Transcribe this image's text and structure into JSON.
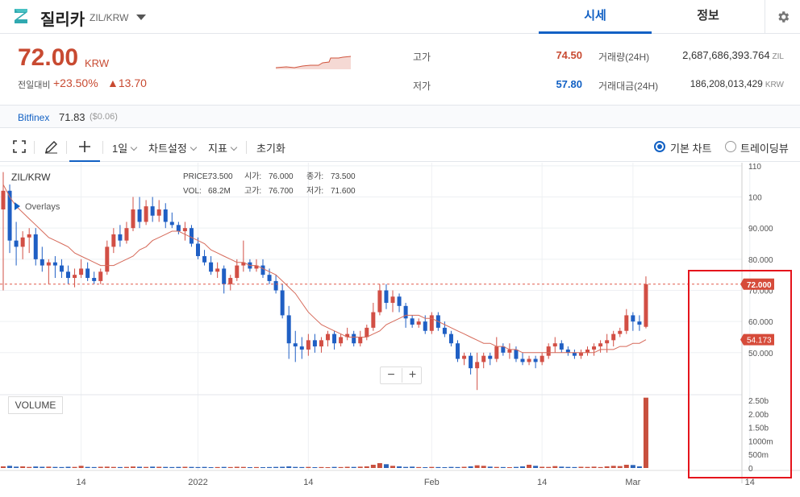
{
  "header": {
    "coin_name": "질리카",
    "pair": "ZIL/KRW",
    "tabs": [
      "시세",
      "정보"
    ],
    "active_tab": "시세"
  },
  "ticker": {
    "price": "72.00",
    "currency": "KRW",
    "change_label": "전일대비",
    "change_rate": "+23.50%",
    "change_amount": "▲13.70",
    "high_label": "고가",
    "high_value": "74.50",
    "low_label": "저가",
    "low_value": "57.80",
    "volume_label": "거래량(24H)",
    "volume_value": "2,687,686,393.764",
    "volume_unit": "ZIL",
    "amount_label": "거래대금(24H)",
    "amount_value": "186,208,013,429",
    "amount_unit": "KRW"
  },
  "bitfinex": {
    "name": "Bitfinex",
    "price": "71.83",
    "diff": "($0.06)"
  },
  "toolbar": {
    "interval": "1일",
    "chart_settings": "차트설정",
    "indicators": "지표",
    "reset": "초기화",
    "basic_chart": "기본 차트",
    "tradingview": "트레이딩뷰"
  },
  "chart_info": {
    "pair": "ZIL/KRW",
    "overlays": "Overlays",
    "price_label": "PRICE:",
    "price": "73.500",
    "open_label": "시가:",
    "open": "76.000",
    "close_label": "종가:",
    "close": "73.500",
    "vol_label": "VOL:",
    "vol": "68.2M",
    "high_label": "고가:",
    "high": "76.700",
    "low_label": "저가:",
    "low": "71.600",
    "volume_title": "VOLUME",
    "current_price_tag": "72.000",
    "ma_tag": "54.173",
    "zoom_out": "−",
    "zoom_in": "+"
  },
  "chart_data": {
    "type": "candlestick",
    "y_ticks": [
      "110",
      "100",
      "90.000",
      "80.000",
      "70.000",
      "60.000",
      "50.000"
    ],
    "y_tick_values": [
      110,
      100,
      90,
      80,
      70,
      60,
      50
    ],
    "vol_ticks": [
      "2.50b",
      "2.00b",
      "1.50b",
      "1000m",
      "500m",
      "0"
    ],
    "vol_tick_values": [
      2500,
      2000,
      1500,
      1000,
      500,
      0
    ],
    "x_ticks": [
      "14",
      "2022",
      "14",
      "Feb",
      "14",
      "Mar",
      "14"
    ],
    "x_tick_positions": [
      12,
      30,
      47,
      66,
      83,
      97,
      115
    ],
    "price_range": [
      36.5,
      111
    ],
    "vol_range": [
      0,
      2650
    ],
    "current_price": 72,
    "ma_last": 54.173,
    "candles": [
      [
        96,
        108,
        70,
        102
      ],
      [
        102,
        104,
        82,
        86
      ],
      [
        86,
        92,
        78,
        84
      ],
      [
        84,
        89,
        80,
        87
      ],
      [
        87,
        90,
        82,
        88
      ],
      [
        88,
        90,
        78,
        80
      ],
      [
        80,
        84,
        76,
        78
      ],
      [
        78,
        80,
        72,
        79
      ],
      [
        79,
        81,
        74,
        78
      ],
      [
        78,
        80,
        74,
        76
      ],
      [
        76,
        78,
        72,
        74
      ],
      [
        74,
        77,
        71,
        75
      ],
      [
        75,
        80,
        74,
        77
      ],
      [
        77,
        79,
        73,
        74
      ],
      [
        74,
        76,
        72,
        73
      ],
      [
        73,
        77,
        72,
        76
      ],
      [
        76,
        86,
        75,
        84
      ],
      [
        84,
        90,
        82,
        88
      ],
      [
        88,
        91,
        84,
        86
      ],
      [
        86,
        92,
        85,
        90
      ],
      [
        90,
        100,
        89,
        96
      ],
      [
        96,
        100,
        90,
        92
      ],
      [
        92,
        99,
        91,
        97
      ],
      [
        97,
        100,
        92,
        94
      ],
      [
        94,
        99,
        92,
        96
      ],
      [
        96,
        98,
        90,
        92
      ],
      [
        92,
        95,
        90,
        91
      ],
      [
        91,
        92,
        88,
        89
      ],
      [
        89,
        92,
        86,
        90
      ],
      [
        90,
        91,
        84,
        85
      ],
      [
        85,
        87,
        80,
        81
      ],
      [
        81,
        83,
        78,
        79
      ],
      [
        79,
        81,
        75,
        76
      ],
      [
        76,
        79,
        74,
        77
      ],
      [
        77,
        78,
        69,
        72
      ],
      [
        72,
        75,
        70,
        74
      ],
      [
        74,
        80,
        73,
        78
      ],
      [
        78,
        86,
        76,
        79
      ],
      [
        79,
        80,
        76,
        77
      ],
      [
        77,
        80,
        76,
        78
      ],
      [
        78,
        80,
        74,
        75
      ],
      [
        75,
        77,
        72,
        73
      ],
      [
        73,
        75,
        69,
        70
      ],
      [
        70,
        72,
        61,
        62
      ],
      [
        62,
        65,
        48,
        53
      ],
      [
        53,
        57,
        47,
        52
      ],
      [
        52,
        55,
        48,
        51
      ],
      [
        51,
        56,
        49,
        54
      ],
      [
        54,
        56,
        50,
        52
      ],
      [
        52,
        55,
        50,
        54
      ],
      [
        54,
        57,
        52,
        56
      ],
      [
        56,
        57,
        51,
        53
      ],
      [
        53,
        56,
        52,
        55
      ],
      [
        55,
        58,
        54,
        56
      ],
      [
        56,
        57,
        52,
        53
      ],
      [
        53,
        57,
        52,
        55
      ],
      [
        55,
        59,
        54,
        58
      ],
      [
        58,
        66,
        57,
        63
      ],
      [
        63,
        72,
        62,
        70
      ],
      [
        70,
        72,
        64,
        66
      ],
      [
        66,
        70,
        63,
        68
      ],
      [
        68,
        69,
        63,
        65
      ],
      [
        65,
        66,
        58,
        61
      ],
      [
        61,
        62,
        58,
        59
      ],
      [
        59,
        61,
        58,
        60
      ],
      [
        60,
        62,
        56,
        57
      ],
      [
        57,
        63,
        56,
        62
      ],
      [
        62,
        63,
        57,
        58
      ],
      [
        58,
        60,
        55,
        56
      ],
      [
        56,
        57,
        52,
        53
      ],
      [
        53,
        54,
        47,
        48
      ],
      [
        48,
        50,
        46,
        49
      ],
      [
        49,
        50,
        43,
        45
      ],
      [
        45,
        50,
        38,
        47
      ],
      [
        47,
        50,
        45,
        49
      ],
      [
        49,
        50,
        46,
        48
      ],
      [
        48,
        55,
        47,
        52
      ],
      [
        52,
        53,
        49,
        50
      ],
      [
        50,
        53,
        48,
        51
      ],
      [
        51,
        52,
        47,
        48
      ],
      [
        48,
        50,
        46,
        47
      ],
      [
        47,
        49,
        46,
        48
      ],
      [
        48,
        49,
        45,
        47
      ],
      [
        47,
        50,
        46,
        49
      ],
      [
        49,
        53,
        48,
        52
      ],
      [
        52,
        55,
        50,
        53
      ],
      [
        53,
        54,
        50,
        51
      ],
      [
        51,
        52,
        49,
        50
      ],
      [
        50,
        51,
        48,
        49
      ],
      [
        49,
        51,
        48,
        50
      ],
      [
        50,
        52,
        49,
        51
      ],
      [
        51,
        53,
        49,
        52
      ],
      [
        52,
        54,
        50,
        53
      ],
      [
        53,
        56,
        50,
        54
      ],
      [
        54,
        57,
        52,
        56
      ],
      [
        56,
        58,
        55,
        57
      ],
      [
        57,
        64,
        56,
        62
      ],
      [
        62,
        63,
        57,
        60
      ],
      [
        60,
        62,
        57,
        59
      ],
      [
        58.3,
        74.5,
        57.8,
        72
      ]
    ],
    "volumes": [
      60,
      80,
      50,
      60,
      40,
      55,
      45,
      50,
      40,
      35,
      45,
      40,
      80,
      40,
      35,
      45,
      50,
      40,
      35,
      40,
      55,
      45,
      40,
      50,
      45,
      40,
      35,
      40,
      45,
      40,
      35,
      40,
      30,
      35,
      40,
      35,
      45,
      40,
      30,
      35,
      30,
      35,
      40,
      45,
      60,
      40,
      35,
      40,
      30,
      35,
      30,
      40,
      35,
      45,
      40,
      50,
      60,
      120,
      180,
      140,
      80,
      60,
      40,
      50,
      35,
      30,
      40,
      35,
      30,
      40,
      35,
      45,
      60,
      100,
      80,
      50,
      40,
      35,
      30,
      40,
      60,
      120,
      80,
      45,
      40,
      70,
      50,
      40,
      35,
      45,
      40,
      50,
      35,
      60,
      80,
      70,
      120,
      110,
      60,
      2600
    ],
    "ma": [
      104,
      100,
      97,
      95,
      93,
      91,
      89,
      87,
      86,
      85,
      84,
      82,
      81,
      80,
      79,
      78,
      78,
      78,
      79,
      80,
      81,
      83,
      84,
      86,
      87,
      88,
      89,
      89,
      88,
      87,
      86,
      85,
      83,
      82,
      81,
      80,
      79,
      79,
      78,
      78,
      77,
      76,
      75,
      73,
      71,
      69,
      66,
      63,
      61,
      59,
      58,
      57,
      56,
      55,
      55,
      55,
      55,
      56,
      57,
      59,
      60,
      61,
      62,
      62,
      62,
      61,
      61,
      60,
      59,
      58,
      57,
      56,
      55,
      54,
      53,
      53,
      52,
      52,
      51,
      51,
      50,
      50,
      50,
      50,
      50,
      50,
      50,
      50,
      50,
      50,
      50,
      50,
      51,
      51,
      51,
      52,
      52,
      53,
      53,
      54.173
    ]
  }
}
